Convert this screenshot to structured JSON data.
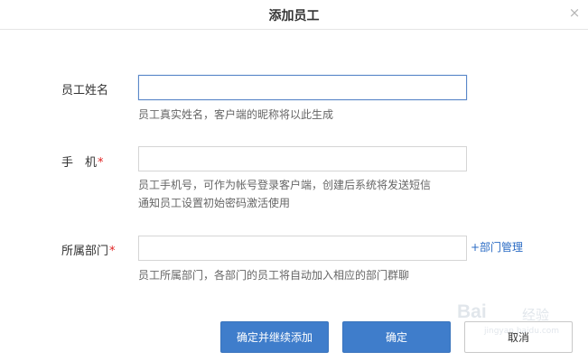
{
  "dialog": {
    "title": "添加员工",
    "close_icon": "close-icon"
  },
  "form": {
    "name": {
      "label": "员工姓名",
      "value": "",
      "placeholder": "",
      "hint": "员工真实姓名，客户端的昵称将以此生成"
    },
    "phone": {
      "label": "手　机",
      "required_mark": "*",
      "value": "",
      "placeholder": "",
      "hint_line1": "员工手机号，可作为帐号登录客户端，创建后系统将发送短信",
      "hint_line2": "通知员工设置初始密码激活使用"
    },
    "department": {
      "label": "所属部门",
      "required_mark": "*",
      "value": "",
      "placeholder": "",
      "manage_link": "+部门管理",
      "hint": "员工所属部门，各部门的员工将自动加入相应的部门群聊"
    }
  },
  "buttons": {
    "save_and_continue": "确定并继续添加",
    "confirm": "确定",
    "cancel": "取消"
  },
  "watermark": {
    "brand": "Bai",
    "sub": "经验",
    "url": "jingyan.baidu.com"
  },
  "colors": {
    "primary": "#3f7dcb",
    "required": "#e02020",
    "link": "#2a6bc4",
    "focus_border": "#5b88c9"
  }
}
